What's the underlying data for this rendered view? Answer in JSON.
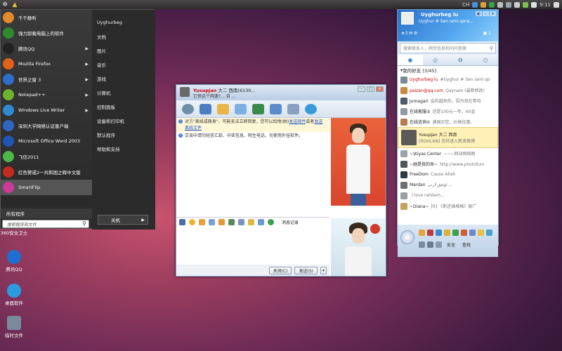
{
  "topbar": {
    "clock": "9:11",
    "lang": "CH"
  },
  "startmenu": {
    "left_items": [
      {
        "label": "千千静听",
        "color": "#e38a2a",
        "arrow": false
      },
      {
        "label": "强力卸载电脑上的软件",
        "color": "#2f8a2f",
        "arrow": false
      },
      {
        "label": "腾讯QQ",
        "color": "#222222",
        "arrow": true
      },
      {
        "label": "Mozilla Firefox",
        "color": "#e2621c",
        "arrow": true
      },
      {
        "label": "世界之窗 3",
        "color": "#2b6fc9",
        "arrow": true
      },
      {
        "label": "Notepad++",
        "color": "#6eb32f",
        "arrow": true
      },
      {
        "label": "Windows Live Writer",
        "color": "#2e8bd2",
        "arrow": true
      },
      {
        "label": "深圳大学网络认证客户端",
        "color": "#3066c2",
        "arrow": false
      },
      {
        "label": "Microsoft Office Word 2003",
        "color": "#1f55b5",
        "arrow": false
      },
      {
        "label": "飞信2011",
        "color": "#4cb848",
        "arrow": false
      },
      {
        "label": "红色警戒2一共和国之辉中文版",
        "color": "#c42b20",
        "arrow": false
      },
      {
        "label": "SmartFlip",
        "color": "#cc3a9a",
        "arrow": false
      }
    ],
    "all_programs": "所有程序",
    "search_placeholder": "搜索程序和文件",
    "right_items": [
      "Uyghurbeg",
      "文档",
      "图片",
      "音乐",
      "游戏",
      "计算机",
      "控制面板",
      "设备和打印机",
      "默认程序",
      "帮助和支持"
    ],
    "shutdown": "关机"
  },
  "desktop_icons": [
    {
      "label": "360安全卫士",
      "color": "#3aa14f"
    },
    {
      "label": "腾讯QQ",
      "color": "#1f6fd2"
    },
    {
      "label": "桌面软件",
      "color": "#2a9be0"
    },
    {
      "label": "临时文件",
      "color": "#7a8a9a"
    }
  ],
  "chat": {
    "name": "Yusupjan",
    "name_suffix": "大二 西南(6130...",
    "signature": "它快这个网速?... 自 ...",
    "notices": [
      {
        "text": "对方\"离线或隐身\"，可能无法立即回复，您可以给他(她)",
        "link": "发送邮件",
        "text2": "或者",
        "link2": "发送离线文件"
      },
      {
        "text": "交谈中请勿轻信汇款、中奖信息、陌生电话，勿使用外挂软件。"
      }
    ],
    "history": "消息记录",
    "close": "关闭(C)",
    "send": "发送(S)"
  },
  "qq": {
    "name": "Uyghurbeg lu",
    "signature": "Uyghur # Sen iami qora...",
    "level": "3",
    "count": "1",
    "search_placeholder": "搜索联系人，网页信息和问问答案",
    "group": "我的好友 [3/45]",
    "contacts": [
      {
        "name": "Uyghurbeg lu",
        "sig": "#Uyghur # Sen iami qo",
        "red": true,
        "color": "#7b8b96"
      },
      {
        "name": "paizan@qq.com",
        "sig": "Qaynam (最新修改)",
        "red": true,
        "color": "#c78a44"
      },
      {
        "name": "Jumagari",
        "sig": "会的越来的，因为我在等待",
        "red": false,
        "color": "#4e5b68"
      },
      {
        "name": "在线客服③",
        "sig": "还是100元一年，60金",
        "red": false,
        "color": "#8d9da8"
      },
      {
        "name": "在线咨询①",
        "sig": "满国买您，价格优惠。",
        "red": false,
        "color": "#b77b52"
      },
      {
        "name": "Yusupjan 大二 西南",
        "sig": "[ROHLAN] 怎样进入新浪微博",
        "red": false,
        "color": "#5a5a5a",
        "selected": true
      },
      {
        "name": "~\\Kiyas Center",
        "sig": "~~~网站网络图",
        "red": false,
        "color": "#9aa4ac"
      },
      {
        "name": "~她是我的命~",
        "sig": "http://www.photofuni",
        "red": false,
        "color": "#50565e"
      },
      {
        "name": "FreeDom",
        "sig": "Cause Allah",
        "red": false,
        "color": "#2f3a46"
      },
      {
        "name": "Mardan",
        "sig": "ئۇيغۇرلارنى ...",
        "red": false,
        "color": "#6c6f74"
      },
      {
        "name": "",
        "sig": "I love rahilem...",
        "red": false,
        "color": "#98a1a8"
      },
      {
        "name": "~Diana~",
        "sig": "[R] 《新还珠格格》被广",
        "red": false,
        "color": "#c6a35a"
      }
    ],
    "safe": "安全",
    "find": "查找"
  }
}
